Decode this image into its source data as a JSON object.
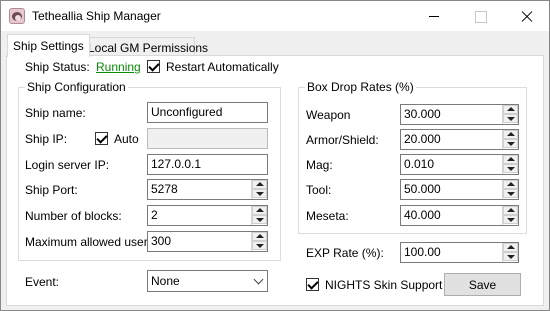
{
  "window": {
    "title": "Tetheallia Ship Manager"
  },
  "tabs": [
    {
      "label": "Ship Settings",
      "active": true
    },
    {
      "label": "Local GM Permissions",
      "active": false
    }
  ],
  "status": {
    "label": "Ship Status:",
    "value": "Running",
    "value_color": "#0a8a0a",
    "restart_label": "Restart Automatically",
    "restart_checked": true
  },
  "ship_config": {
    "title": "Ship Configuration",
    "name_label": "Ship name:",
    "name_value": "Unconfigured",
    "ip_label": "Ship IP:",
    "auto_label": "Auto",
    "auto_checked": true,
    "ip_value": "",
    "login_label": "Login server IP:",
    "login_value": "127.0.0.1",
    "port_label": "Ship Port:",
    "port_value": "5278",
    "blocks_label": "Number of blocks:",
    "blocks_value": "2",
    "users_label": "Maximum allowed users:",
    "users_value": "300"
  },
  "event": {
    "label": "Event:",
    "selected": "None"
  },
  "drop_rates": {
    "title": "Box Drop Rates (%)",
    "items": [
      {
        "label": "Weapon",
        "value": "30.000"
      },
      {
        "label": "Armor/Shield:",
        "value": "20.000"
      },
      {
        "label": "Mag:",
        "value": "0.010"
      },
      {
        "label": "Tool:",
        "value": "50.000"
      },
      {
        "label": "Meseta:",
        "value": "40.000"
      }
    ]
  },
  "exp": {
    "label": "EXP Rate (%):",
    "value": "100.00"
  },
  "nights": {
    "label": "NIGHTS Skin Support",
    "checked": true
  },
  "save_label": "Save"
}
